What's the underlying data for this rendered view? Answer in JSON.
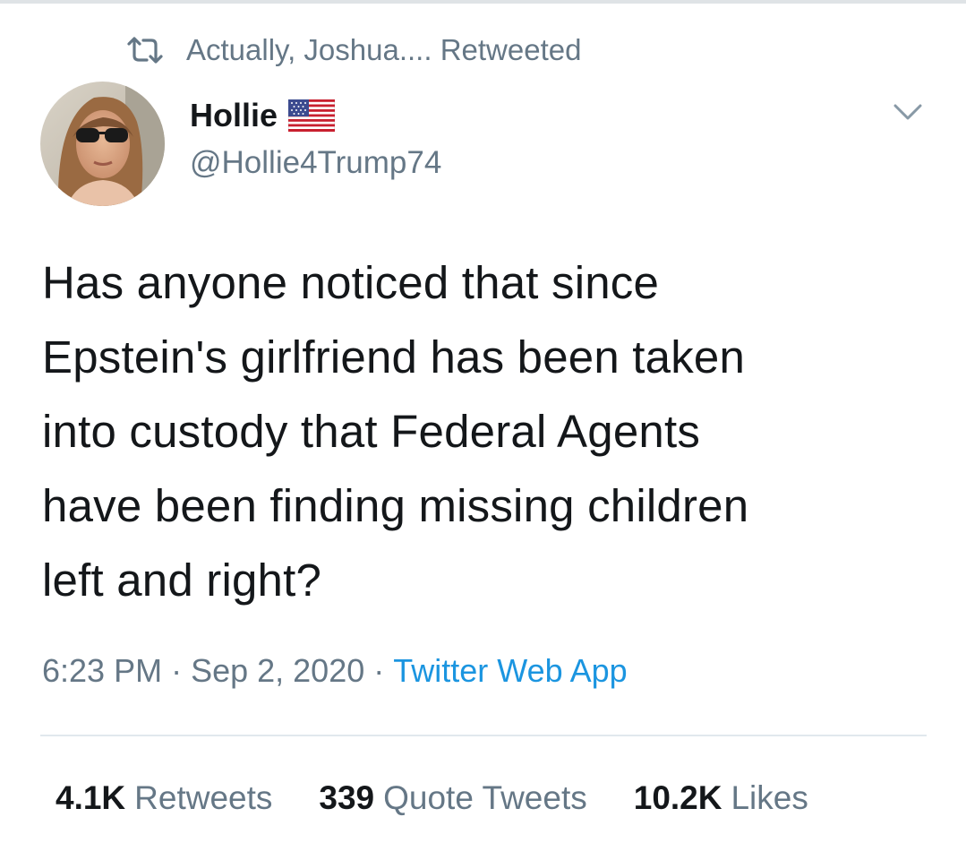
{
  "retweet_context": {
    "text": "Actually, Joshua.... Retweeted",
    "icon": "retweet-icon"
  },
  "author": {
    "name": "Hollie",
    "handle": "@Hollie4Trump74",
    "name_emoji": "us-flag-icon",
    "avatar": "profile-photo"
  },
  "tweet": {
    "lines": [
      "Has anyone noticed that since",
      "Epstein's girlfriend has been taken",
      "into custody that Federal Agents",
      "have been finding missing children",
      "left and right?"
    ]
  },
  "meta": {
    "time": "6:23 PM",
    "separator": "·",
    "date": "Sep 2, 2020",
    "source": "Twitter Web App"
  },
  "stats": {
    "retweets": {
      "count": "4.1K",
      "label": "Retweets"
    },
    "quotes": {
      "count": "339",
      "label": "Quote Tweets"
    },
    "likes": {
      "count": "10.2K",
      "label": "Likes"
    }
  },
  "colors": {
    "text": "#14171a",
    "secondary": "#657786",
    "link": "#1b95e0",
    "divider": "#e1e8ed"
  }
}
